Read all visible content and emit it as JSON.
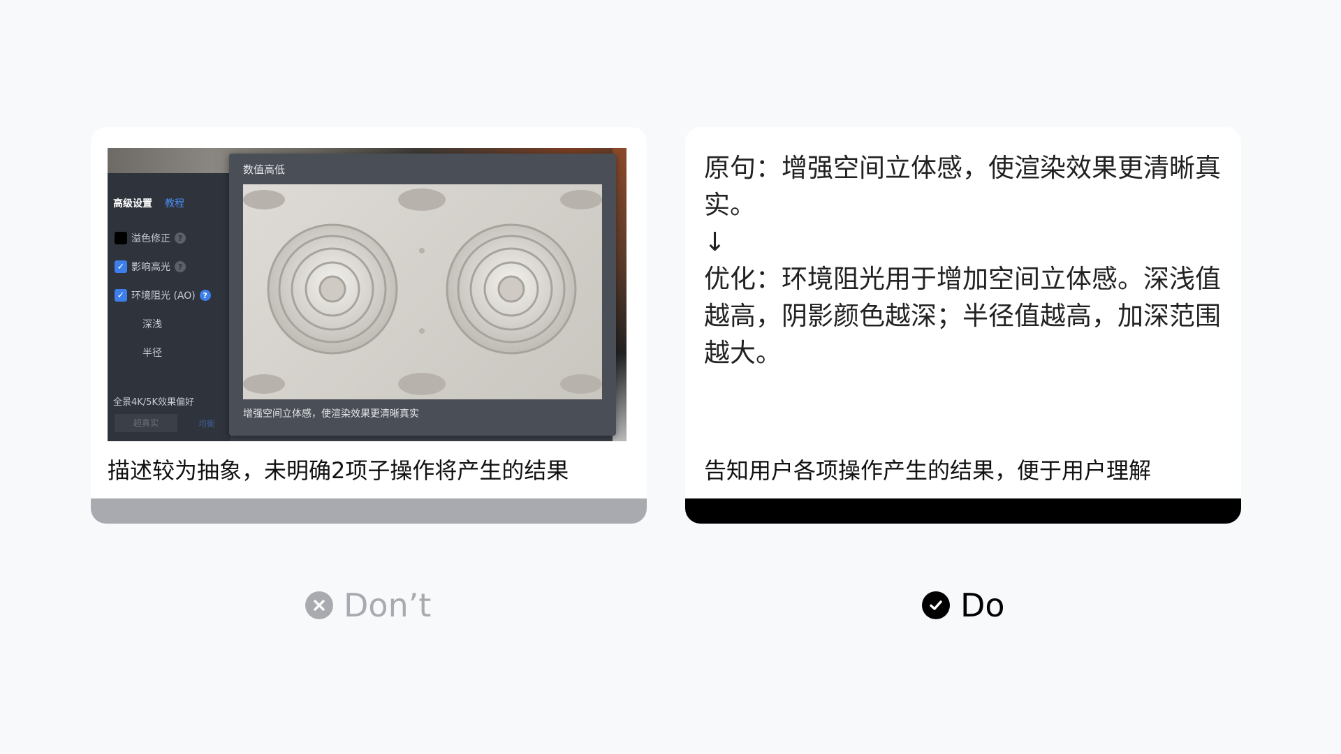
{
  "dont": {
    "screenshot": {
      "sidebar_title": "高级设置",
      "sidebar_link": "教程",
      "options": [
        {
          "label": "溢色修正",
          "checked": false
        },
        {
          "label": "影响高光",
          "checked": true
        },
        {
          "label": "环境阻光 (AO)",
          "checked": true
        }
      ],
      "sub_depth": "深浅",
      "sub_radius": "半径",
      "footer_text": "全景4K/5K效果偏好",
      "button_a": "超真实",
      "button_b": "均衡",
      "panel_title": "数值高低",
      "panel_caption": "增强空间立体感，使渲染效果更清晰真实"
    },
    "caption": "描述较为抽象，未明确2项子操作将产生的结果",
    "label": "Don’t",
    "icon": "x-circle-icon",
    "bar_color": "#a9aaaf"
  },
  "do": {
    "lines": [
      "原句：增强空间立体感，使渲染效果更清晰真实。",
      "↓",
      "优化：环境阻光用于增加空间立体感。深浅值越高，阴影颜色越深；半径值越高，加深范围越大。"
    ],
    "caption": "告知用户各项操作产生的结果，便于用户理解",
    "label": "Do",
    "icon": "check-circle-icon",
    "bar_color": "#000000"
  }
}
